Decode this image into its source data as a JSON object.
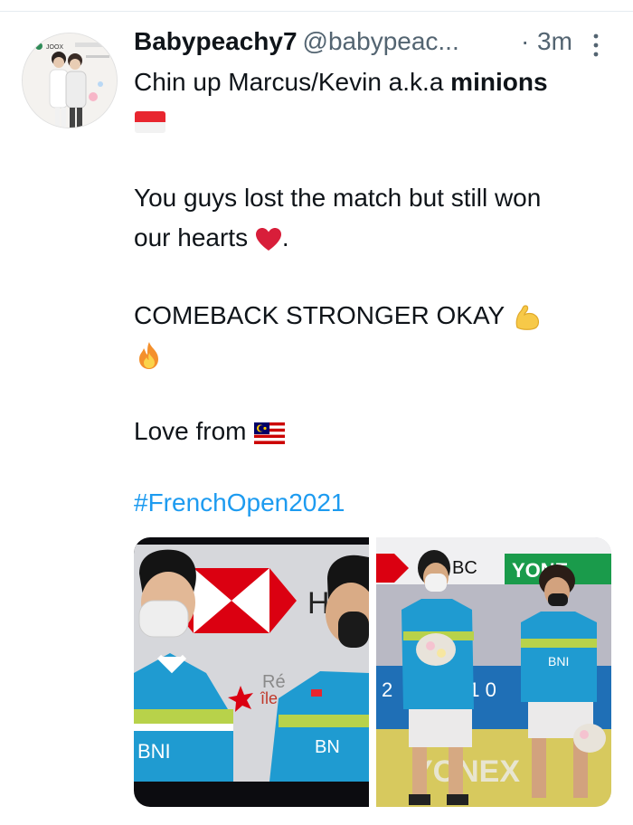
{
  "tweet": {
    "display_name": "Babypeachy7",
    "handle": "@babypeac...",
    "dot": "·",
    "time": "3m",
    "line1_prefix": "Chin up Marcus/Kevin a.k.a ",
    "line1_bold": "minions",
    "line2": "You guys lost the match but still won",
    "line3_text": "our hearts",
    "line3_suffix": ".",
    "line4": "COMEBACK STRONGER OKAY",
    "line5": "Love from",
    "hashtag": "#FrenchOpen2021"
  },
  "emojis": [
    "indonesia-flag",
    "red-heart",
    "flexed-biceps",
    "fire",
    "malaysia-flag"
  ],
  "media": {
    "left_banner_letter": "H",
    "left_banner_text": "Ré",
    "left_banner_text2": "île",
    "left_shirt_text": "BNI",
    "left_shirt_text2": "BN",
    "right_banner_text": "BC",
    "right_brand": "YONE",
    "right_shirt_text": "BNI",
    "right_score1": "2",
    "right_score2": "31 0",
    "right_floor_text": "YONEX"
  },
  "colors": {
    "text": "#0f1419",
    "muted": "#536471",
    "link": "#1d9bf0",
    "hsbc_red": "#db0011",
    "shirt_blue": "#1f9bd1",
    "yonex_green": "#1a9b4b"
  }
}
